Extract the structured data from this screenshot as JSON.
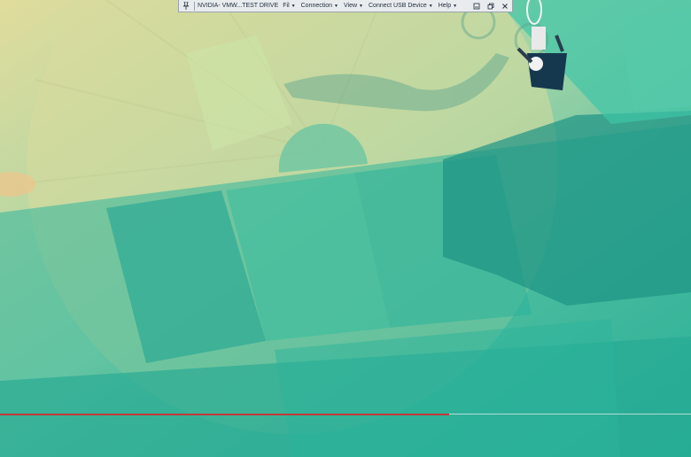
{
  "toolbar": {
    "title": "NVIDIA- VMW...TEST DRIVE",
    "menus": [
      {
        "label": "Fil"
      },
      {
        "label": "Connection"
      },
      {
        "label": "View"
      },
      {
        "label": "Connect USB Device"
      },
      {
        "label": "Help"
      }
    ],
    "icons": [
      "pin-icon",
      "minimize-icon",
      "restore-icon",
      "close-icon"
    ]
  },
  "video": {
    "progress_fraction": 0.65
  },
  "colors": {
    "accent_teal": "#2fb8a0",
    "ramp_yellow": "#d4d79a",
    "shadow_teal": "#1e8f80",
    "progress_red": "#c0393b"
  }
}
